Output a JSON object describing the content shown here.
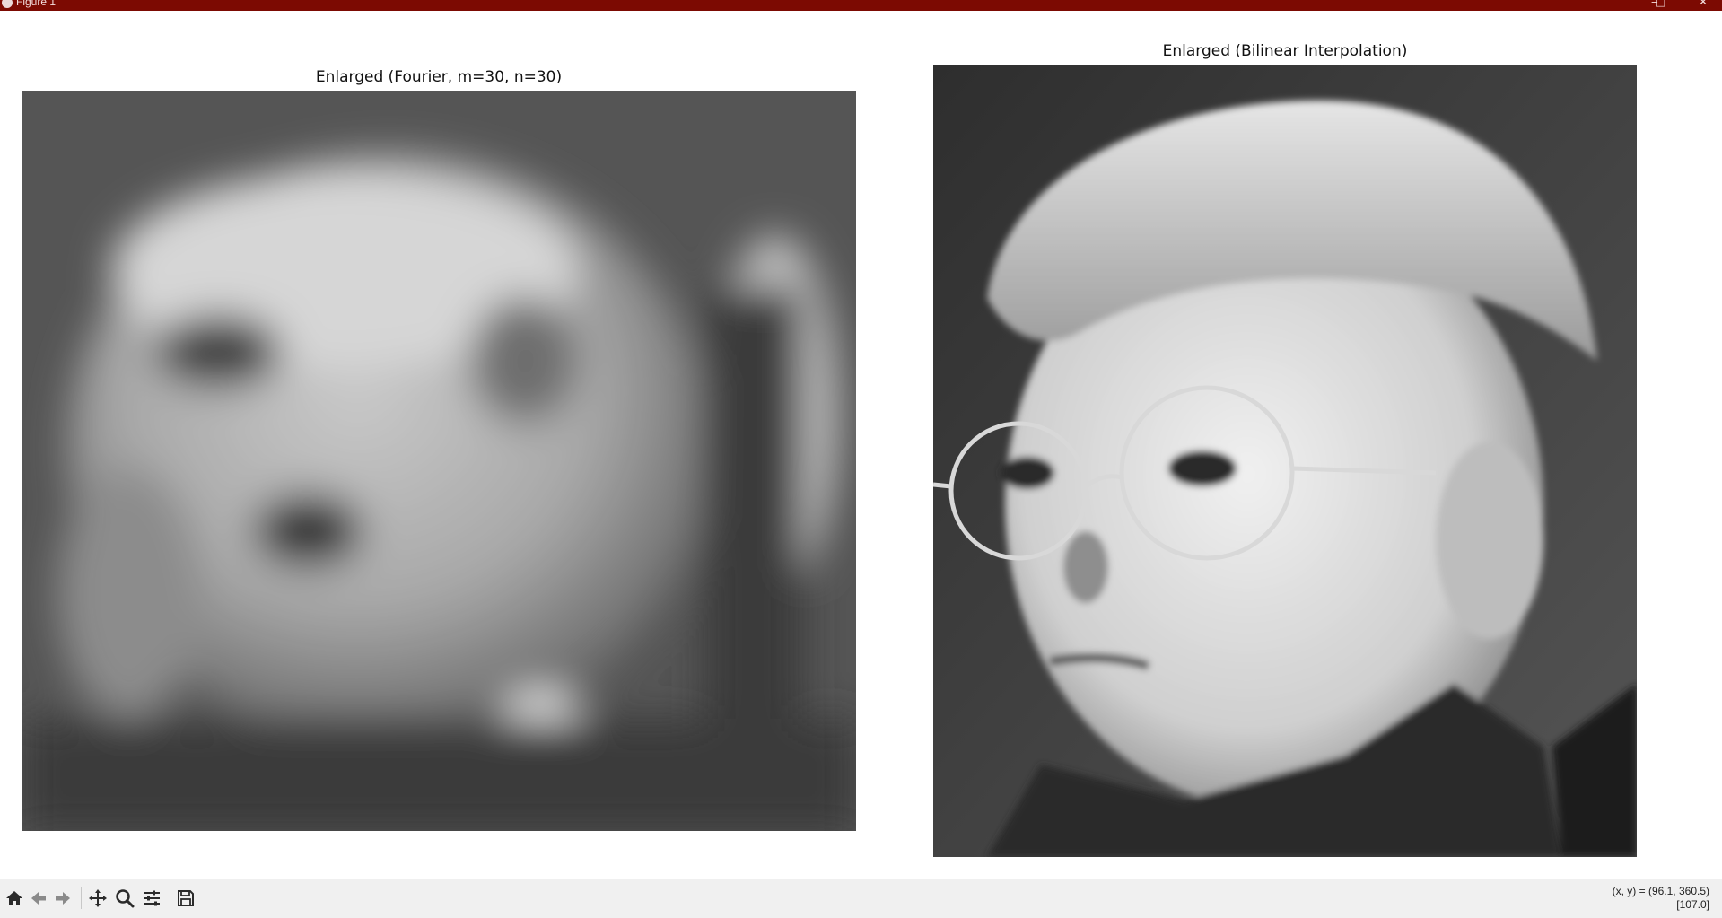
{
  "window": {
    "title": "Figure 1",
    "buttons": {
      "minimize": "‒",
      "maximize": "□",
      "close": "✕"
    }
  },
  "figure": {
    "left_axes": {
      "title": "Enlarged (Fourier, m=30, n=30)",
      "image_description_icon": "grayscale-blurred-photo"
    },
    "right_axes": {
      "title": "Enlarged (Bilinear Interpolation)",
      "image_description_icon": "grayscale-photo"
    }
  },
  "toolbar": {
    "items": [
      {
        "name": "home-icon",
        "tooltip": "Reset original view"
      },
      {
        "name": "back-icon",
        "tooltip": "Back to previous view"
      },
      {
        "name": "forward-icon",
        "tooltip": "Forward to next view"
      },
      {
        "name": "pan-icon",
        "tooltip": "Pan axes"
      },
      {
        "name": "zoom-icon",
        "tooltip": "Zoom to rectangle"
      },
      {
        "name": "configure-subplots-icon",
        "tooltip": "Configure subplots"
      },
      {
        "name": "save-icon",
        "tooltip": "Save the figure"
      }
    ],
    "coords_line1": "(x, y) = (96.1, 360.5)",
    "coords_line2": "[107.0]"
  },
  "colors": {
    "titlebar": "#7c0a02",
    "toolbar_bg": "#f0f0f0",
    "icon": "#2b2b2b"
  }
}
